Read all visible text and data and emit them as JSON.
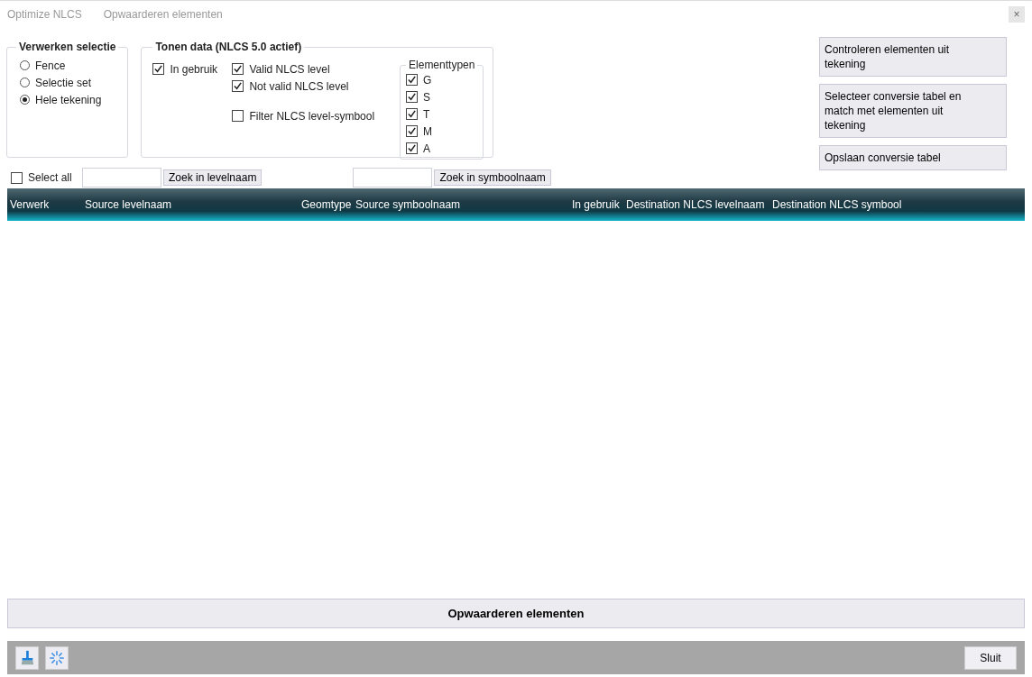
{
  "tabs": [
    {
      "label": "Optimize NLCS"
    },
    {
      "label": "Opwaarderen elementen"
    }
  ],
  "close_button": "×",
  "verwerken_selectie": {
    "title": "Verwerken selectie",
    "options": [
      {
        "label": "Fence",
        "selected": false
      },
      {
        "label": "Selectie set",
        "selected": false
      },
      {
        "label": "Hele tekening",
        "selected": true
      }
    ]
  },
  "tonen_data": {
    "title": "Tonen data (NLCS 5.0 actief)",
    "in_gebruik": {
      "label": "In gebruik",
      "checked": true
    },
    "levels": [
      {
        "label": "Valid NLCS level",
        "checked": true
      },
      {
        "label": "Not valid NLCS level",
        "checked": true
      }
    ],
    "filter": {
      "label": "Filter NLCS level-symbool",
      "checked": false
    },
    "elementtypen": {
      "title": "Elementtypen",
      "items": [
        {
          "label": "G",
          "checked": true
        },
        {
          "label": "S",
          "checked": true
        },
        {
          "label": "T",
          "checked": true
        },
        {
          "label": "M",
          "checked": true
        },
        {
          "label": "A",
          "checked": true
        }
      ]
    }
  },
  "side_buttons": [
    "Controleren elementen uit tekening",
    "Selecteer conversie tabel en match met elementen uit tekening",
    "Opslaan conversie tabel"
  ],
  "select_all": {
    "label": "Select all",
    "checked": false
  },
  "search_level_button": "Zoek in levelnaam",
  "search_symbol_button": "Zoek in symboolnaam",
  "table": {
    "columns": [
      "Verwerk",
      "Source levelnaam",
      "Geomtype",
      "Source symboolnaam",
      "In gebruik",
      "Destination NLCS levelnaam",
      "Destination NLCS symbool"
    ]
  },
  "main_button": "Opwaarderen elementen",
  "close_footer_button": "Sluit"
}
